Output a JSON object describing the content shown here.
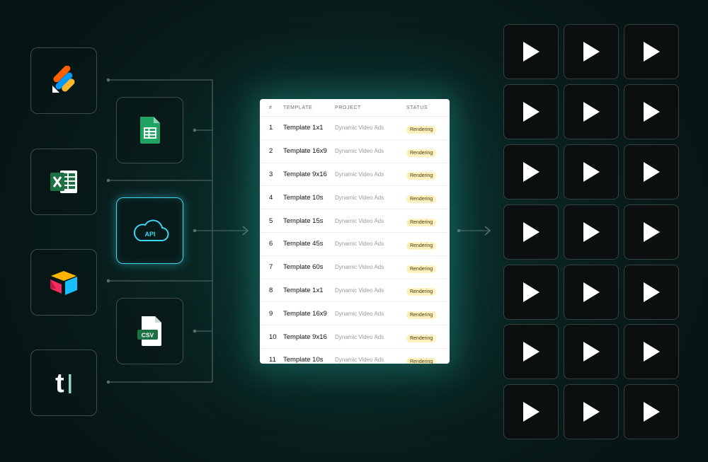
{
  "sources": [
    {
      "id": "jotform",
      "icon": "jotform-icon"
    },
    {
      "id": "excel",
      "icon": "excel-icon"
    },
    {
      "id": "airtable",
      "icon": "airtable-icon"
    },
    {
      "id": "typeform",
      "icon": "typeform-icon",
      "letter": "t"
    }
  ],
  "inputs": [
    {
      "id": "google-sheets",
      "icon": "google-sheets-icon"
    },
    {
      "id": "api",
      "icon": "cloud-api-icon",
      "label": "API"
    },
    {
      "id": "csv",
      "icon": "csv-file-icon",
      "label": "CSV"
    }
  ],
  "table": {
    "columns": [
      "#",
      "TEMPLATE",
      "PROJECT",
      "STATUS"
    ],
    "rows": [
      {
        "num": "1",
        "template": "Template 1x1",
        "project": "Dynamic Video Ads",
        "status": "Rendering"
      },
      {
        "num": "2",
        "template": "Template 16x9",
        "project": "Dynamic Video Ads",
        "status": "Rendering"
      },
      {
        "num": "3",
        "template": "Template 9x16",
        "project": "Dynamic Video Ads",
        "status": "Rendering"
      },
      {
        "num": "4",
        "template": "Template 10s",
        "project": "Dynamic Video Ads",
        "status": "Rendering"
      },
      {
        "num": "5",
        "template": "Template 15s",
        "project": "Dynamic Video Ads",
        "status": "Rendering"
      },
      {
        "num": "6",
        "template": "Template 45s",
        "project": "Dynamic Video Ads",
        "status": "Rendering"
      },
      {
        "num": "7",
        "template": "Template 60s",
        "project": "Dynamic Video Ads",
        "status": "Rendering"
      },
      {
        "num": "8",
        "template": "Template 1x1",
        "project": "Dynamic Video Ads",
        "status": "Rendering"
      },
      {
        "num": "9",
        "template": "Template 16x9",
        "project": "Dynamic Video Ads",
        "status": "Rendering"
      },
      {
        "num": "10",
        "template": "Template 9x16",
        "project": "Dynamic Video Ads",
        "status": "Rendering"
      },
      {
        "num": "11",
        "template": "Template 10s",
        "project": "Dynamic Video Ads",
        "status": "Rendering"
      }
    ]
  },
  "outputs": {
    "rows": 7,
    "columns": 3,
    "icon": "play-icon"
  },
  "colors": {
    "accent": "#3fd6ef",
    "connector": "#4c5f5c",
    "badge_bg": "#fff2bf",
    "sheets_green": "#1fa463",
    "excel_green": "#1e7145",
    "jotform_orange": "#ff6100",
    "jotform_blue": "#0099ff",
    "jotform_yellow": "#ffb629",
    "airtable_yellow": "#fcb400",
    "airtable_blue": "#18bfff",
    "airtable_red": "#f82b60",
    "typeform_accent": "#8fd8c9"
  }
}
